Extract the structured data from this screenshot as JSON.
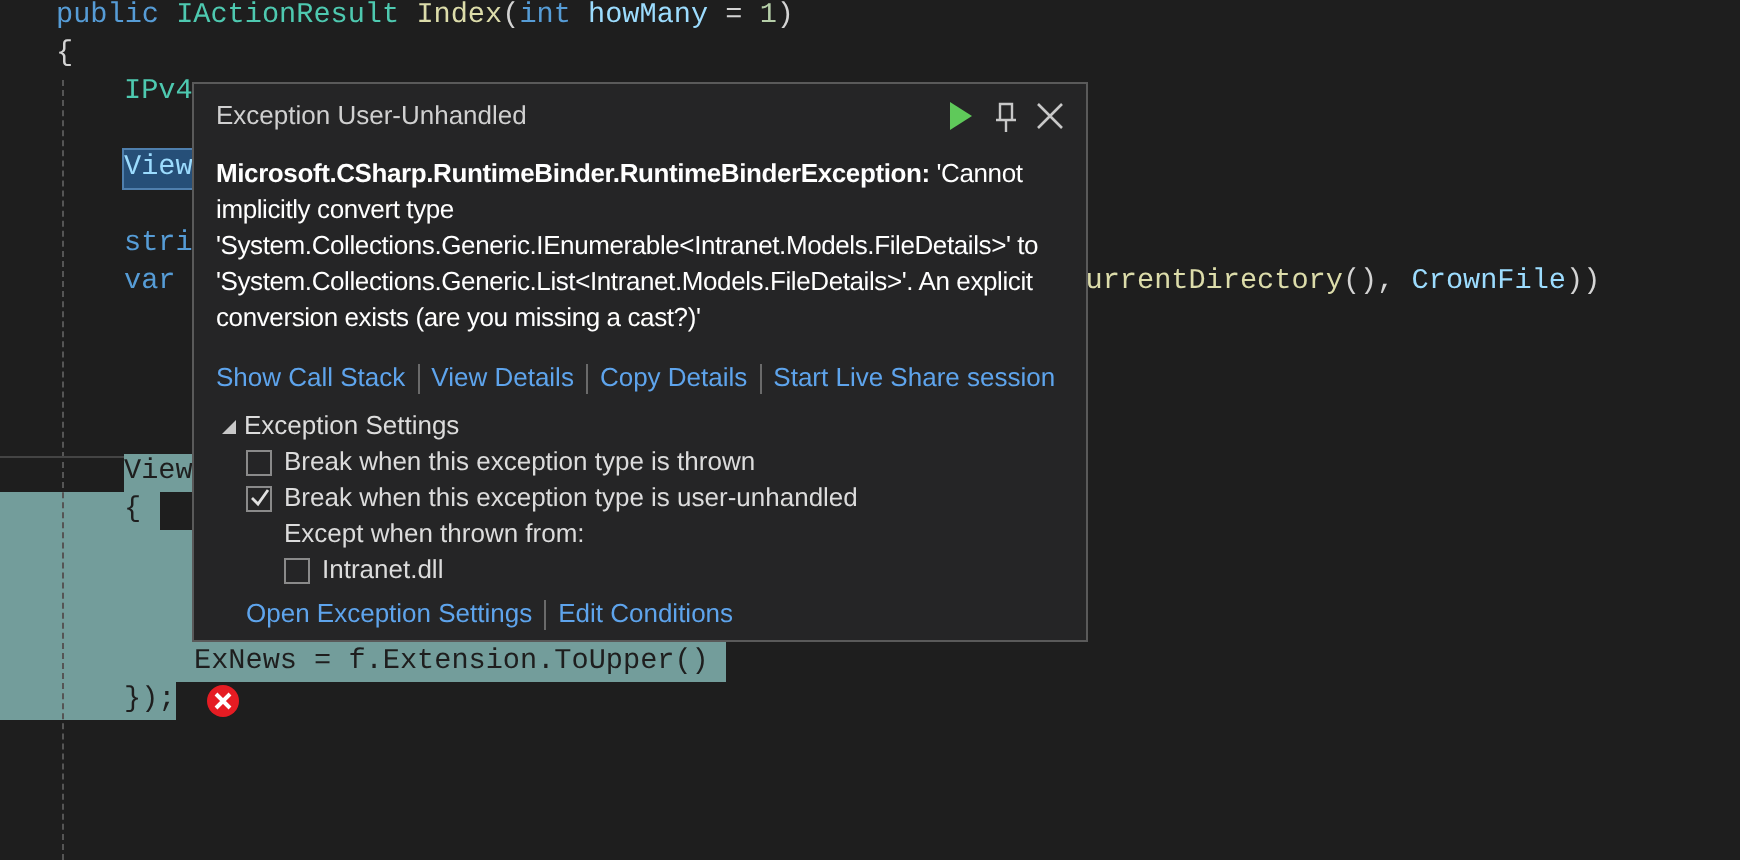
{
  "code_lines": [
    {
      "kind": "code",
      "segments": [
        {
          "text": "public ",
          "kind": "keyword"
        },
        {
          "text": "IActionResult ",
          "kind": "type"
        },
        {
          "text": "Index",
          "kind": "method"
        },
        {
          "text": "(",
          "kind": "plain"
        },
        {
          "text": "int ",
          "kind": "keyword"
        },
        {
          "text": "howMany",
          "kind": "param"
        },
        {
          "text": " = ",
          "kind": "plain"
        },
        {
          "text": "1",
          "kind": "number"
        },
        {
          "text": ")",
          "kind": "plain"
        }
      ]
    },
    {
      "kind": "code",
      "segments": [
        {
          "text": "{",
          "kind": "plain"
        }
      ],
      "children": [
        {
          "kind": "code",
          "segments": [
            {
              "text": "IPv4",
              "kind": "type"
            }
          ]
        },
        {
          "kind": "code"
        },
        {
          "kind": "code",
          "segments": [
            {
              "text": "View",
              "kind": "highlight"
            }
          ]
        },
        {
          "kind": "code"
        },
        {
          "kind": "code",
          "segments": [
            {
              "text": "stri",
              "kind": "keyword"
            }
          ]
        },
        {
          "kind": "code",
          "segments": [
            {
              "text": "var",
              "kind": "keyword"
            }
          ],
          "tail_segments": [
            {
              "text": "urrentDirectory",
              "kind": "method"
            },
            {
              "text": "(), ",
              "kind": "plain"
            },
            {
              "text": "CrownFile",
              "kind": "param"
            },
            {
              "text": "))",
              "kind": "plain"
            }
          ]
        },
        {
          "kind": "code"
        },
        {
          "kind": "code"
        },
        {
          "kind": "code"
        },
        {
          "kind": "code"
        },
        {
          "kind": "selected",
          "segments": [
            {
              "text": "View",
              "kind": "plain"
            }
          ]
        },
        {
          "kind": "selected",
          "segments": [
            {
              "text": "{",
              "kind": "plain"
            }
          ],
          "children": [
            {
              "kind": "selected"
            },
            {
              "kind": "selected"
            },
            {
              "kind": "selected"
            },
            {
              "kind": "selected",
              "segments": [
                {
                  "text": "ExNews = f.Extension.ToUpper()",
                  "kind": "plain"
                }
              ]
            }
          ]
        },
        {
          "kind": "selected",
          "segments": [
            {
              "text": "});",
              "kind": "plain"
            }
          ]
        }
      ]
    }
  ],
  "exception_popup": {
    "title": "Exception User-Unhandled",
    "message": "**Microsoft.CSharp.RuntimeBinder.RuntimeBinderException:** 'Cannot implicitly convert type 'System.Collections.Generic.IEnumerable<Intranet.Models.FileDetails>' to 'System.Collections.Generic.List<Intranet.Models.FileDetails>'. An explicit conversion exists (are you missing a cast?)'",
    "links": [
      "Show Call Stack",
      "View Details",
      "Copy Details",
      "Start Live Share session"
    ],
    "settings": {
      "label": "Exception Settings",
      "expanded": true,
      "options": [
        {
          "kind": "checkbox",
          "label": "Break when this exception type is thrown",
          "checked": false
        },
        {
          "kind": "checkbox",
          "label": "Break when this exception type is user-unhandled",
          "checked": true
        },
        {
          "kind": "caption",
          "label": "Except when thrown from:"
        },
        {
          "kind": "subcheckbox",
          "label": "Intranet.dll",
          "checked": false
        }
      ]
    },
    "footer_links": [
      "Open Exception Settings",
      "Edit Conditions"
    ]
  }
}
